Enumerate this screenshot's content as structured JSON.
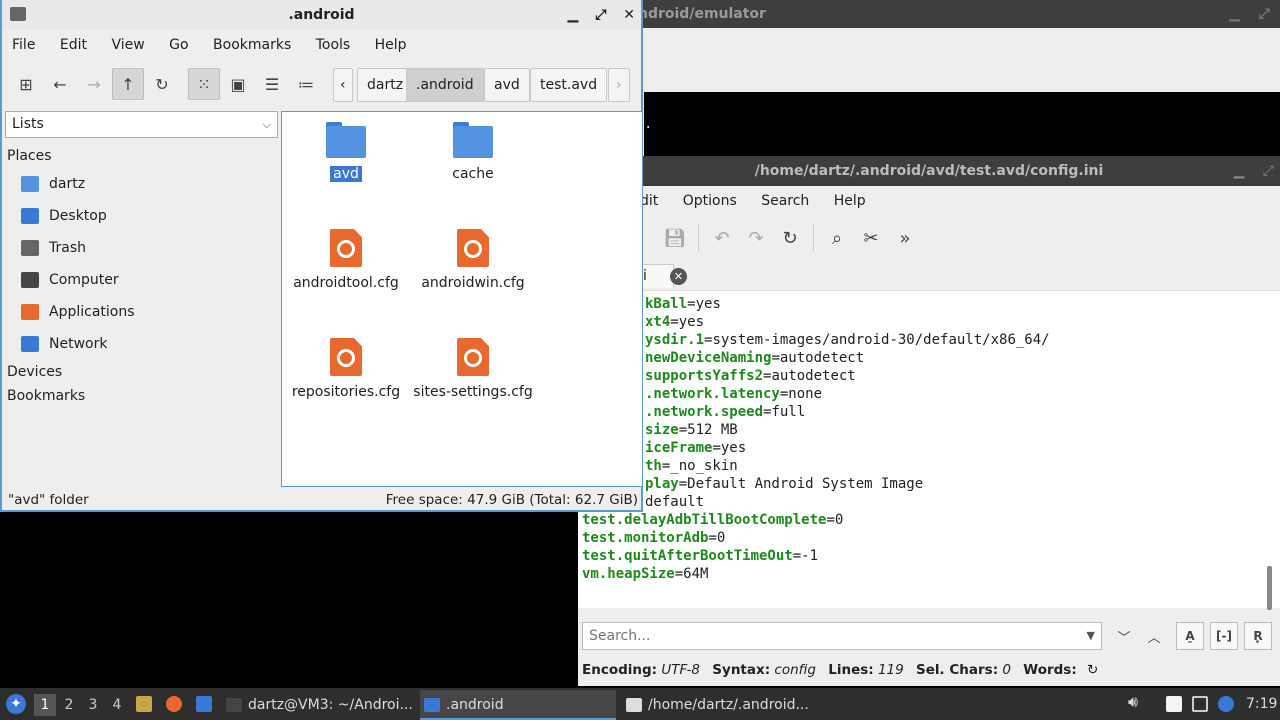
{
  "terminal_window": {
    "title": "ndroid/emulator",
    "visible_text": "."
  },
  "file_manager": {
    "title": ".android",
    "menu": [
      "File",
      "Edit",
      "View",
      "Go",
      "Bookmarks",
      "Tools",
      "Help"
    ],
    "breadcrumbs": [
      "dartz",
      ".android",
      "avd",
      "test.avd"
    ],
    "active_breadcrumb": ".android",
    "side_pane_mode": "Lists",
    "places_header": "Places",
    "places": [
      {
        "label": "dartz",
        "icon": "home-folder-icon",
        "color": "#5294e2"
      },
      {
        "label": "Desktop",
        "icon": "desktop-icon",
        "color": "#3a78d8"
      },
      {
        "label": "Trash",
        "icon": "trash-icon",
        "color": "#666666"
      },
      {
        "label": "Computer",
        "icon": "computer-icon",
        "color": "#444444"
      },
      {
        "label": "Applications",
        "icon": "applications-icon",
        "color": "#e8692e"
      },
      {
        "label": "Network",
        "icon": "network-icon",
        "color": "#3a78d8"
      }
    ],
    "devices_header": "Devices",
    "bookmarks_header": "Bookmarks",
    "files": [
      {
        "name": "avd",
        "type": "folder",
        "selected": true
      },
      {
        "name": "cache",
        "type": "folder",
        "selected": false
      },
      {
        "name": "androidtool.cfg",
        "type": "cfg",
        "selected": false
      },
      {
        "name": "androidwin.cfg",
        "type": "cfg",
        "selected": false
      },
      {
        "name": "repositories.cfg",
        "type": "cfg",
        "selected": false
      },
      {
        "name": "sites-settings.cfg",
        "type": "cfg",
        "selected": false
      }
    ],
    "status_left": "\"avd\" folder",
    "status_right": "Free space: 47.9 GiB (Total: 62.7 GiB)"
  },
  "editor": {
    "title": "/home/dartz/.android/avd/test.avd/config.ini",
    "menu": [
      "dit",
      "Options",
      "Search",
      "Help"
    ],
    "tab_label": "i",
    "lines": [
      {
        "k": "kBall",
        "v": "=yes"
      },
      {
        "k": "xt4",
        "v": "=yes"
      },
      {
        "k": "ysdir.1",
        "v": "=system-images/android-30/default/x86_64/"
      },
      {
        "k": "newDeviceNaming",
        "v": "=autodetect"
      },
      {
        "k": "supportsYaffs2",
        "v": "=autodetect"
      },
      {
        "k": ".network.latency",
        "v": "=none"
      },
      {
        "k": ".network.speed",
        "v": "=full"
      },
      {
        "k": "size",
        "v": "=512 MB"
      },
      {
        "k": "iceFrame",
        "v": "=yes"
      },
      {
        "k": "th",
        "v": "=_no_skin"
      },
      {
        "k": "play",
        "v": "=Default Android System Image"
      },
      {
        "k": "",
        "v": "default"
      },
      {
        "k": "test.delayAdbTillBootComplete",
        "v": "=0"
      },
      {
        "k": "test.monitorAdb",
        "v": "=0"
      },
      {
        "k": "test.quitAfterBootTimeOut",
        "v": "=-1"
      },
      {
        "k": "vm.heapSize",
        "v": "=64M"
      }
    ],
    "search_placeholder": "Search...",
    "status": {
      "encoding_label": "Encoding:",
      "encoding": "UTF-8",
      "syntax_label": "Syntax:",
      "syntax": "config",
      "lines_label": "Lines:",
      "lines": "119",
      "sel_label": "Sel. Chars:",
      "sel": "0",
      "words_label": "Words:"
    }
  },
  "taskbar": {
    "workspaces": [
      "1",
      "2",
      "3",
      "4"
    ],
    "active_workspace": "1",
    "tasks": [
      {
        "label": "dartz@VM3: ~/Androi...",
        "icon": "terminal-icon"
      },
      {
        "label": ".android",
        "icon": "folder-icon"
      },
      {
        "label": "/home/dartz/.android...",
        "icon": "text-editor-icon"
      }
    ],
    "active_task": ".android",
    "clock": "7:19"
  }
}
